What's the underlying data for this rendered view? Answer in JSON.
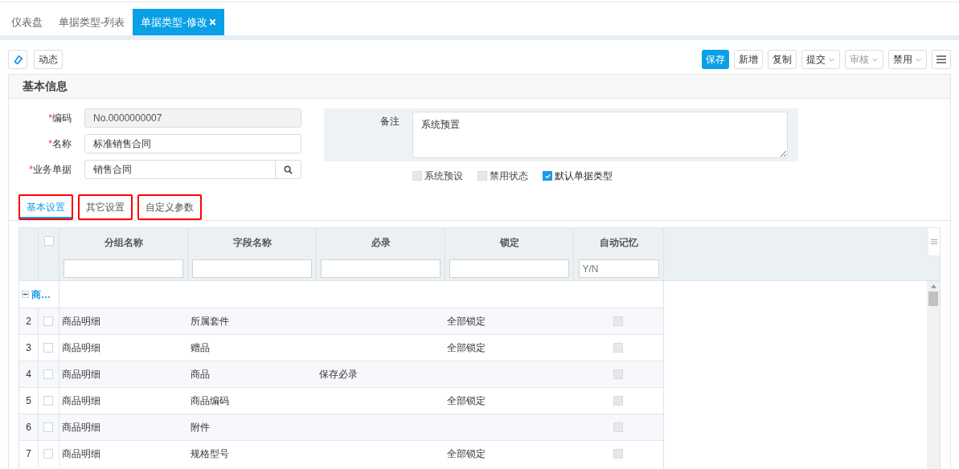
{
  "tabs": [
    {
      "label": "仪表盘",
      "selected": false,
      "closable": false
    },
    {
      "label": "单据类型-列表",
      "selected": false,
      "closable": false
    },
    {
      "label": "单据类型-修改",
      "selected": true,
      "closable": true
    }
  ],
  "toolbar_left": [
    {
      "kind": "icon"
    },
    {
      "kind": "text",
      "label": "动态"
    }
  ],
  "toolbar_right": [
    {
      "kind": "primary",
      "label": "保存"
    },
    {
      "kind": "plain",
      "label": "新增"
    },
    {
      "kind": "plain",
      "label": "复制"
    },
    {
      "kind": "dropdown",
      "label": "提交",
      "disabled": false
    },
    {
      "kind": "dropdown",
      "label": "审核",
      "disabled": true
    },
    {
      "kind": "dropdown",
      "label": "禁用",
      "disabled": false
    },
    {
      "kind": "menu"
    }
  ],
  "panel": {
    "title": "基本信息",
    "fields": [
      {
        "required_mark": "*",
        "label": "编码",
        "value": "No.0000000007",
        "readonly": true,
        "lookup": false
      },
      {
        "required_mark": "*",
        "label": "名称",
        "value": "标准销售合同",
        "readonly": false,
        "lookup": false
      },
      {
        "required_mark": "*",
        "label": "业务单据",
        "value": "销售合同",
        "readonly": false,
        "lookup": true
      }
    ],
    "remark": {
      "label": "备注",
      "value": "系统预置"
    },
    "checkboxes": [
      {
        "label": "系统预设",
        "checked": false,
        "disabled": true
      },
      {
        "label": "禁用状态",
        "checked": false,
        "disabled": true
      },
      {
        "label": "默认单据类型",
        "checked": true,
        "disabled": false
      }
    ]
  },
  "sub_tabs": [
    {
      "label": "基本设置",
      "selected": true
    },
    {
      "label": "其它设置",
      "selected": false
    },
    {
      "label": "自定义参数",
      "selected": false
    }
  ],
  "grid": {
    "select_all_checked": false,
    "columns": [
      {
        "label": "分组名称"
      },
      {
        "label": "字段名称"
      },
      {
        "label": "必录"
      },
      {
        "label": "锁定"
      },
      {
        "label": "自动记忆",
        "placeholder": "Y/N"
      }
    ],
    "group": {
      "label": "商…",
      "expanded": true
    },
    "rows": [
      {
        "num": "2",
        "group": "商品明细",
        "field": "所属套件",
        "lock": "全部锁定",
        "checked": false,
        "auto": false
      },
      {
        "num": "3",
        "group": "商品明细",
        "field": "赠品",
        "lock": "全部锁定",
        "checked": false,
        "auto": false
      },
      {
        "num": "4",
        "group": "商品明细",
        "field": "商品",
        "required": "保存必录",
        "checked": false,
        "auto": false
      },
      {
        "num": "5",
        "group": "商品明细",
        "field": "商品编码",
        "lock": "全部锁定",
        "checked": false,
        "auto": false
      },
      {
        "num": "6",
        "group": "商品明细",
        "field": "附件",
        "checked": false,
        "auto": false
      },
      {
        "num": "7",
        "group": "商品明细",
        "field": "规格型号",
        "lock": "全部锁定",
        "checked": false,
        "auto": false
      }
    ]
  }
}
